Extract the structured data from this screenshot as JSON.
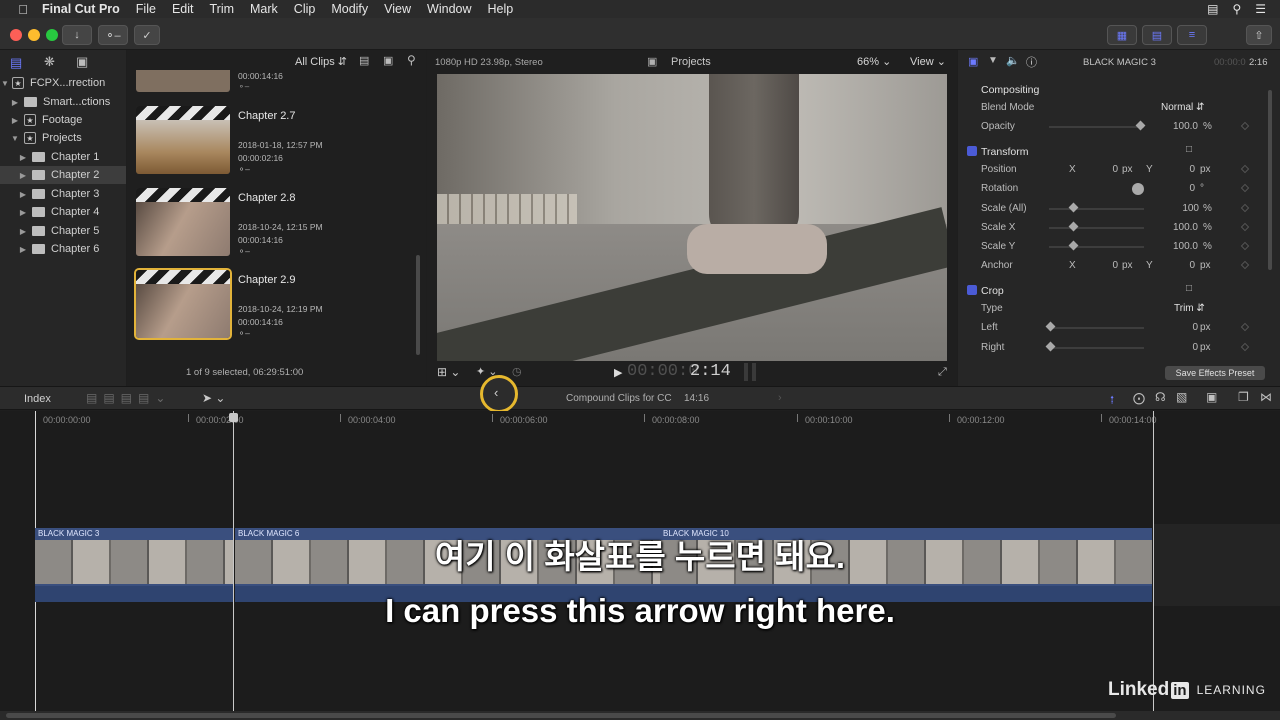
{
  "menubar": {
    "app": "Final Cut Pro",
    "items": [
      "File",
      "Edit",
      "Trim",
      "Mark",
      "Clip",
      "Modify",
      "View",
      "Window",
      "Help"
    ]
  },
  "toolbar": {
    "buttons": [
      "download-icon",
      "key-icon",
      "check-icon"
    ]
  },
  "sidebar": {
    "library": "FCPX...rrection",
    "items": [
      {
        "label": "Smart...ctions",
        "type": "folder"
      },
      {
        "label": "Footage",
        "type": "event"
      },
      {
        "label": "Projects",
        "type": "event"
      },
      {
        "label": "Chapter 1",
        "type": "folder"
      },
      {
        "label": "Chapter 2",
        "type": "folder"
      },
      {
        "label": "Chapter 3",
        "type": "folder"
      },
      {
        "label": "Chapter 4",
        "type": "folder"
      },
      {
        "label": "Chapter 5",
        "type": "folder"
      },
      {
        "label": "Chapter 6",
        "type": "folder"
      }
    ]
  },
  "browser": {
    "filter": "All Clips",
    "top_meta": "00:00:14:16",
    "clips": [
      {
        "title": "Chapter 2.7",
        "date": "2018-01-18, 12:57 PM",
        "duration": "00:00:02:16"
      },
      {
        "title": "Chapter 2.8",
        "date": "2018-10-24, 12:15 PM",
        "duration": "00:00:14:16"
      },
      {
        "title": "Chapter 2.9",
        "date": "2018-10-24, 12:19 PM",
        "duration": "00:00:14:16"
      }
    ],
    "status": "1 of 9 selected, 06:29:51:00"
  },
  "viewer": {
    "format": "1080p HD 23.98p, Stereo",
    "title": "Projects",
    "zoom": "66%",
    "view": "View",
    "timecode": "2:14",
    "timecode_dim": "00:00:0"
  },
  "inspector": {
    "clip_name": "BLACK MAGIC 3",
    "time": "2:16",
    "compositing": "Compositing",
    "blend_mode_label": "Blend Mode",
    "blend_mode": "Normal",
    "opacity_label": "Opacity",
    "opacity": "100.0",
    "transform": "Transform",
    "position_label": "Position",
    "rotation_label": "Rotation",
    "scale_all_label": "Scale (All)",
    "scale_x_label": "Scale X",
    "scale_y_label": "Scale Y",
    "anchor_label": "Anchor",
    "x": "X",
    "y": "Y",
    "zero": "0",
    "px": "px",
    "pct": "%",
    "deg": "°",
    "scale_all": "100",
    "scale_x": "100.0",
    "scale_y": "100.0",
    "crop": "Crop",
    "type_label": "Type",
    "type": "Trim",
    "left_label": "Left",
    "right_label": "Right",
    "save_preset": "Save Effects Preset"
  },
  "timeline": {
    "index": "Index",
    "project": "Compound Clips for CC",
    "duration": "14:16",
    "ruler": [
      "00:00:00:00",
      "00:00:02:00",
      "00:00:04:00",
      "00:00:06:00",
      "00:00:08:00",
      "00:00:10:00",
      "00:00:12:00",
      "00:00:14:00"
    ],
    "clips": [
      "BLACK MAGIC 3",
      "BLACK MAGIC 6",
      "BLACK MAGIC 10"
    ]
  },
  "subtitles": {
    "korean": "여기 이 화살표를 누르면 돼요.",
    "english": "I can press this arrow right here."
  },
  "watermark": {
    "brand_a": "Linked",
    "brand_b": "in",
    "brand_c": "LEARNING"
  },
  "colors": {
    "accent": "#5a6cff",
    "selection_yellow": "#e2b33a",
    "clip_blue": "#3a4f7e"
  }
}
